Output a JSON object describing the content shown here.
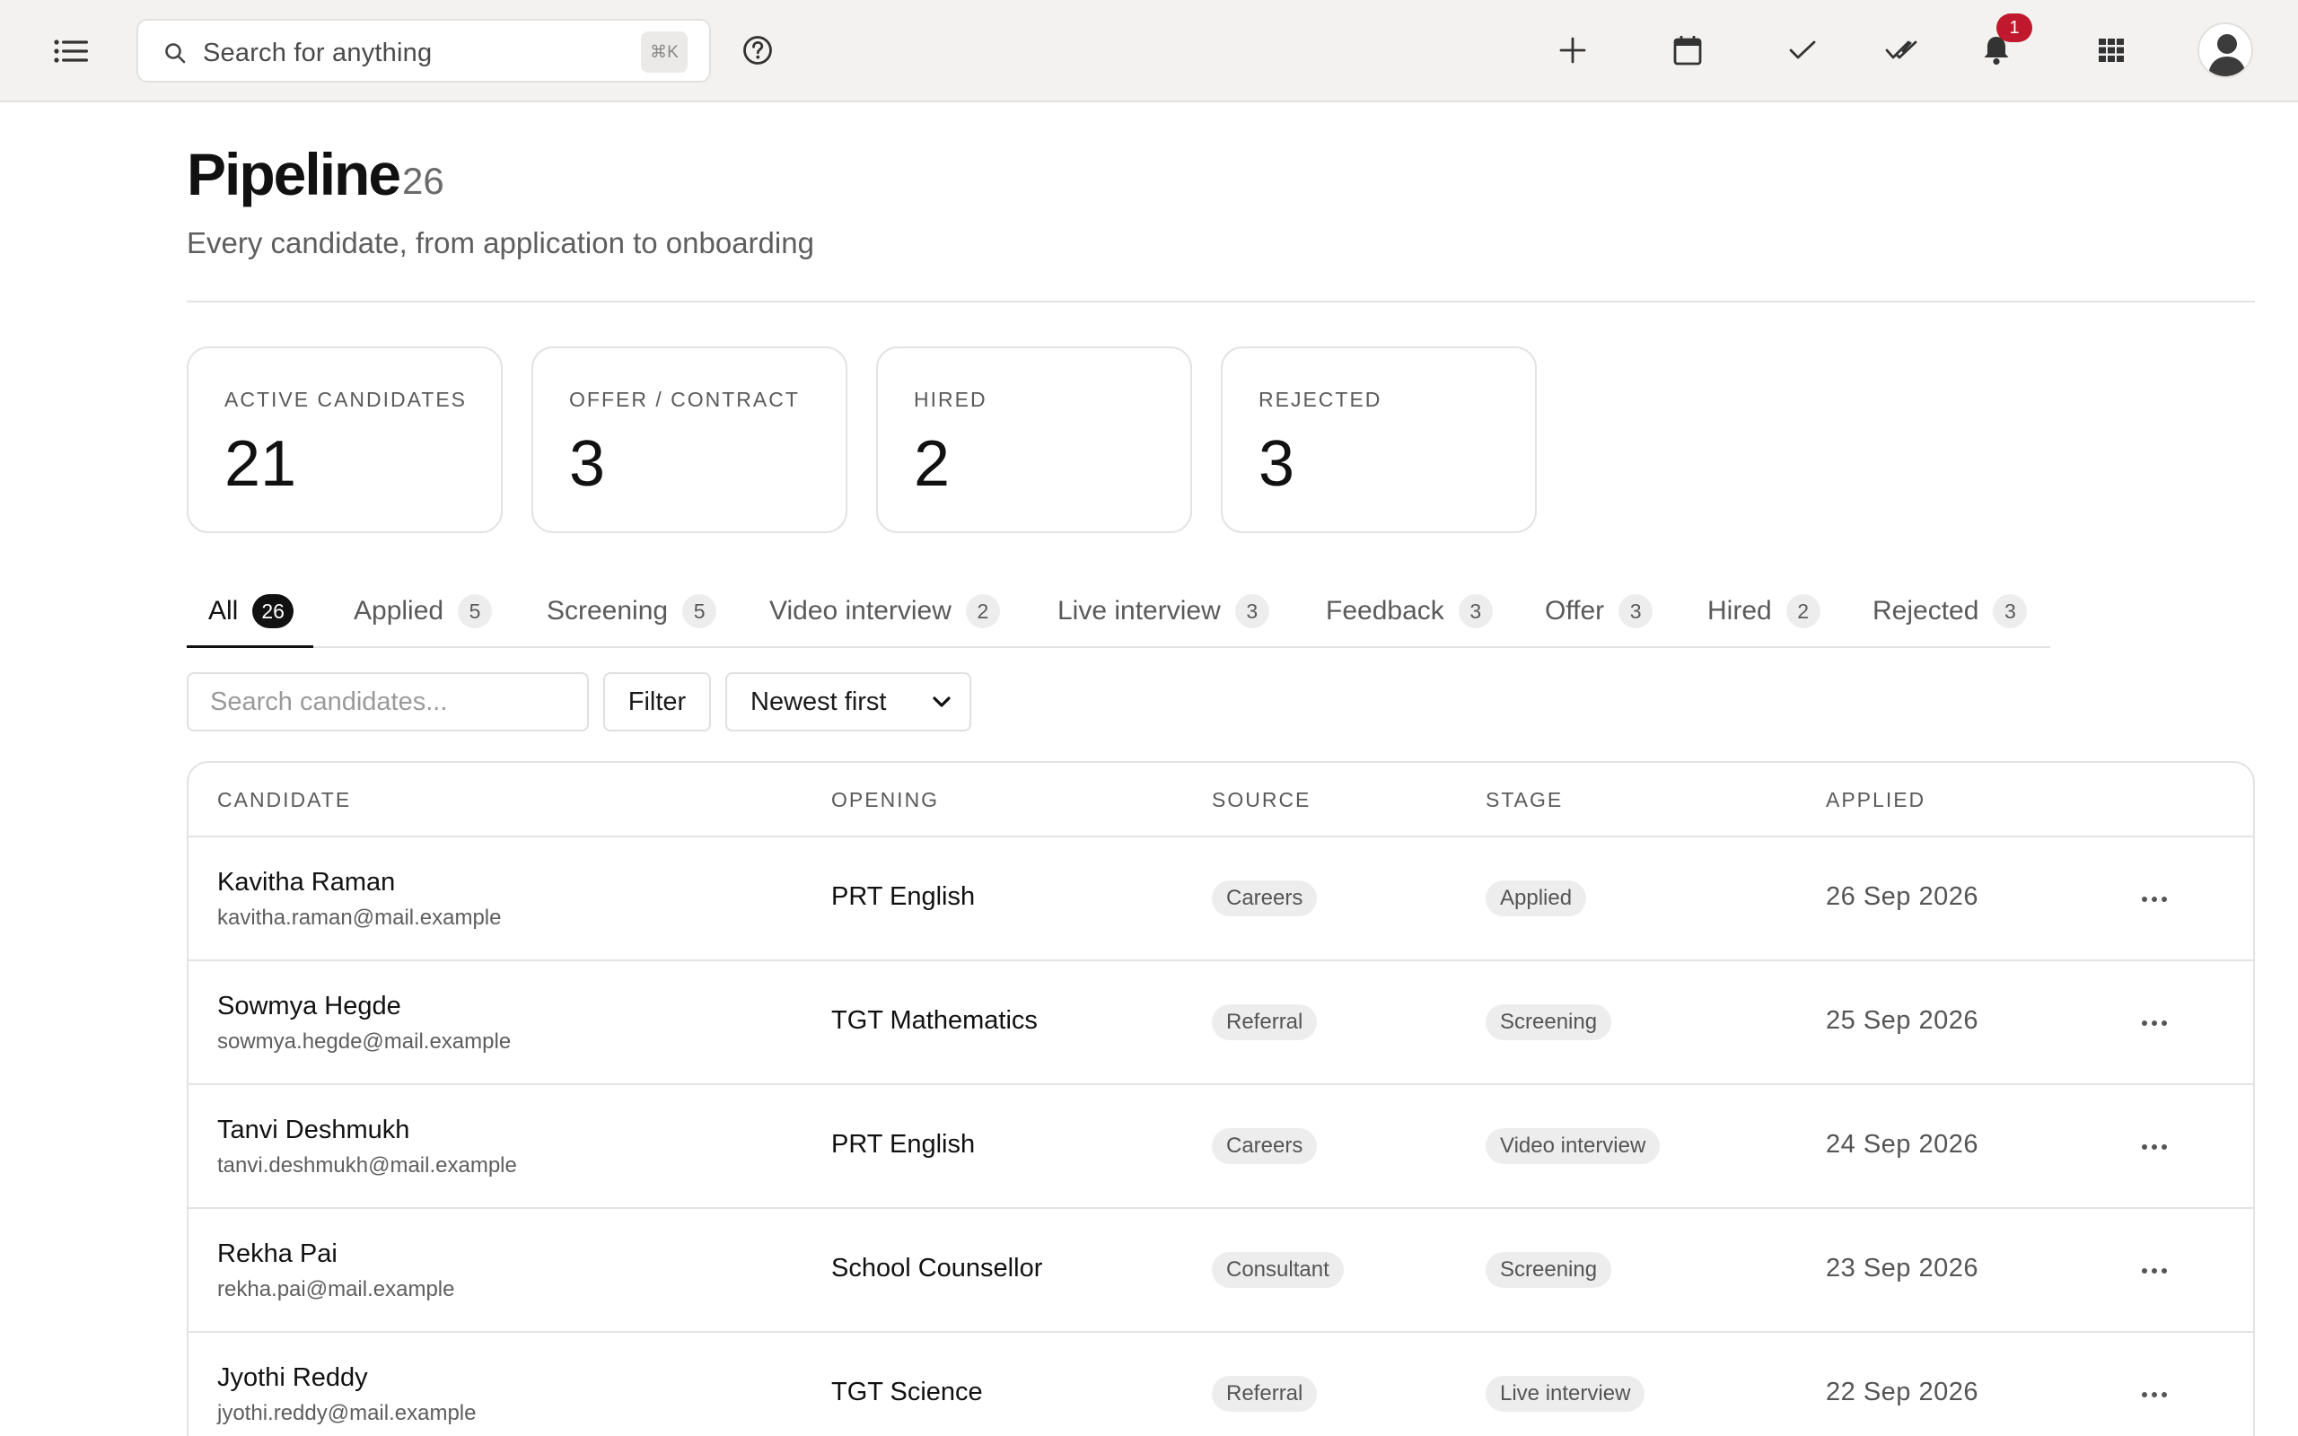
{
  "topbar": {
    "search_placeholder": "Search for anything",
    "search_shortcut": "⌘K",
    "notification_count": "1"
  },
  "header": {
    "title": "Pipeline",
    "count": "26",
    "subtitle": "Every candidate, from application to onboarding"
  },
  "stats": [
    {
      "label": "ACTIVE CANDIDATES",
      "value": "21"
    },
    {
      "label": "OFFER / CONTRACT",
      "value": "3"
    },
    {
      "label": "HIRED",
      "value": "2"
    },
    {
      "label": "REJECTED",
      "value": "3"
    }
  ],
  "tabs": [
    {
      "label": "All",
      "count": "26",
      "active": true
    },
    {
      "label": "Applied",
      "count": "5"
    },
    {
      "label": "Screening",
      "count": "5"
    },
    {
      "label": "Video interview",
      "count": "2"
    },
    {
      "label": "Live interview",
      "count": "3"
    },
    {
      "label": "Feedback",
      "count": "3"
    },
    {
      "label": "Offer",
      "count": "3"
    },
    {
      "label": "Hired",
      "count": "2"
    },
    {
      "label": "Rejected",
      "count": "3"
    }
  ],
  "filters": {
    "search_placeholder": "Search candidates...",
    "filter_label": "Filter",
    "sort_value": "Newest first"
  },
  "table": {
    "columns": [
      "CANDIDATE",
      "OPENING",
      "SOURCE",
      "STAGE",
      "APPLIED"
    ],
    "rows": [
      {
        "name": "Kavitha Raman",
        "email": "kavitha.raman@mail.example",
        "opening": "PRT English",
        "source": "Careers",
        "stage": "Applied",
        "applied": "26 Sep 2026"
      },
      {
        "name": "Sowmya Hegde",
        "email": "sowmya.hegde@mail.example",
        "opening": "TGT Mathematics",
        "source": "Referral",
        "stage": "Screening",
        "applied": "25 Sep 2026"
      },
      {
        "name": "Tanvi Deshmukh",
        "email": "tanvi.deshmukh@mail.example",
        "opening": "PRT English",
        "source": "Careers",
        "stage": "Video interview",
        "applied": "24 Sep 2026"
      },
      {
        "name": "Rekha Pai",
        "email": "rekha.pai@mail.example",
        "opening": "School Counsellor",
        "source": "Consultant",
        "stage": "Screening",
        "applied": "23 Sep 2026"
      },
      {
        "name": "Jyothi Reddy",
        "email": "jyothi.reddy@mail.example",
        "opening": "TGT Science",
        "source": "Referral",
        "stage": "Live interview",
        "applied": "22 Sep 2026"
      }
    ]
  }
}
